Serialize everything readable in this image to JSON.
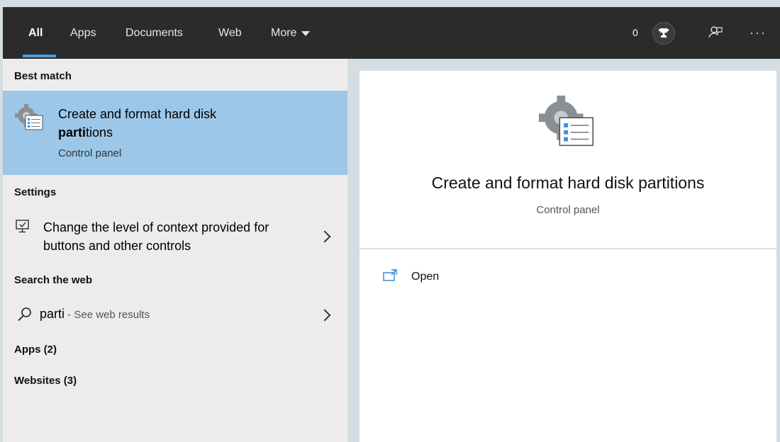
{
  "tabs": [
    {
      "label": "All",
      "active": true
    },
    {
      "label": "Apps",
      "active": false
    },
    {
      "label": "Documents",
      "active": false
    },
    {
      "label": "Web",
      "active": false
    },
    {
      "label": "More",
      "active": false
    }
  ],
  "header": {
    "points": "0",
    "trophy_icon": "trophy-icon",
    "feedback_icon": "feedback-icon",
    "more_icon": "ellipsis-icon",
    "accent_color": "#4a9be0"
  },
  "left": {
    "best_match_heading": "Best match",
    "best_match": {
      "title_prefix": "Create and format hard disk",
      "title_match": "parti",
      "title_suffix": "tions",
      "subtitle": "Control panel",
      "icon": "control-panel-gear-icon",
      "highlight_color": "#9cc7e8"
    },
    "settings_heading": "Settings",
    "settings_item": {
      "label": "Change the level of context provided for buttons and other controls",
      "icon": "ease-of-access-icon"
    },
    "web_heading": "Search the web",
    "web_item": {
      "query": "parti",
      "hint": " - See web results",
      "icon": "search-icon"
    },
    "apps_heading": "Apps (2)",
    "websites_heading": "Websites (3)"
  },
  "preview": {
    "title": "Create and format hard disk partitions",
    "subtitle": "Control panel",
    "icon": "control-panel-gear-icon",
    "actions": [
      {
        "label": "Open",
        "icon": "open-window-icon"
      }
    ]
  }
}
